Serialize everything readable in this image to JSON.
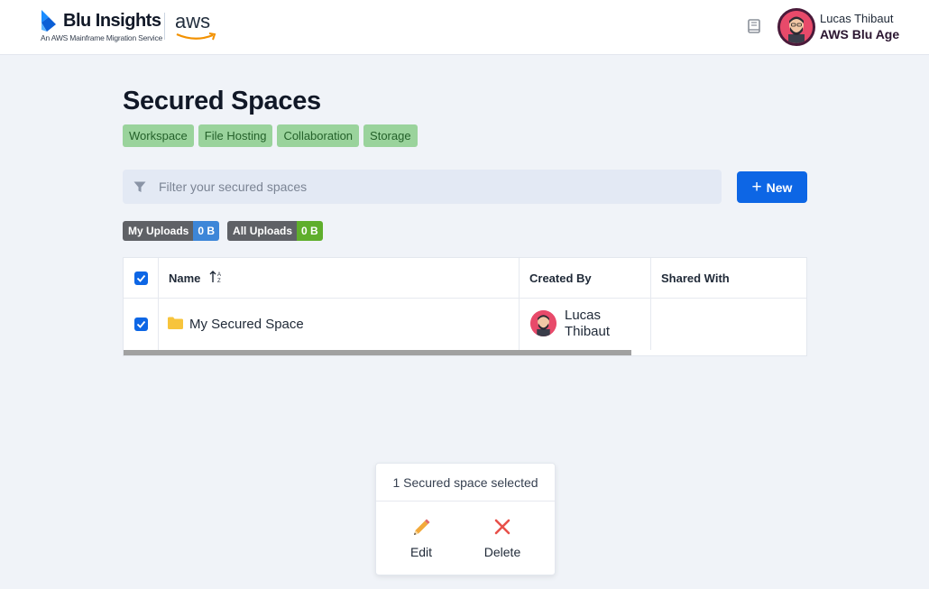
{
  "header": {
    "logo_title": "Blu Insights",
    "logo_subtitle": "An AWS Mainframe Migration Service",
    "aws_logo": "aws",
    "book_icon": "book-icon",
    "user": {
      "name": "Lucas Thibaut",
      "organization": "AWS Blu Age"
    }
  },
  "main": {
    "title": "Secured Spaces",
    "tags": [
      "Workspace",
      "File Hosting",
      "Collaboration",
      "Storage"
    ],
    "filter": {
      "placeholder": "Filter your secured spaces",
      "value": ""
    },
    "new_button": {
      "label": "New",
      "icon": "plus-icon"
    },
    "badges": [
      {
        "label": "My Uploads",
        "value": "0 B",
        "color": "#3d86d8"
      },
      {
        "label": "All Uploads",
        "value": "0 B",
        "color": "#5fae2c"
      }
    ],
    "table": {
      "columns": [
        "Name",
        "Created By",
        "Shared With"
      ],
      "rows": [
        {
          "checked": true,
          "name": "My Secured Space",
          "created_by": "Lucas Thibaut",
          "shared_with": ""
        }
      ]
    }
  },
  "selection_panel": {
    "title": "1 Secured space selected",
    "actions": [
      {
        "label": "Edit",
        "icon": "pencil-icon"
      },
      {
        "label": "Delete",
        "icon": "close-icon"
      }
    ]
  },
  "colors": {
    "primary": "#0d66e5",
    "tag_bg": "#9ad39c",
    "avatar_bg": "#e84a6a",
    "delete": "#e8504a"
  }
}
